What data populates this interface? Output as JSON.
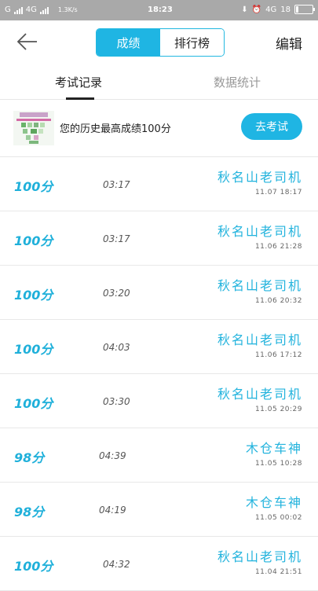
{
  "status_bar": {
    "carrier_left": "G",
    "network": "4G",
    "speed": "1.3K/s",
    "time": "18:23",
    "network_right": "4G",
    "battery_level": "18",
    "battery_fraction": 0.18
  },
  "nav": {
    "tabs": [
      {
        "label": "成绩",
        "active": true
      },
      {
        "label": "排行榜",
        "active": false
      }
    ],
    "edit_label": "编辑"
  },
  "subtabs": [
    {
      "label": "考试记录",
      "active": true
    },
    {
      "label": "数据统计",
      "active": false
    }
  ],
  "best": {
    "text": "您的历史最高成绩100分",
    "button": "去考试"
  },
  "records": [
    {
      "score": "100分",
      "duration": "03:17",
      "name": "秋名山老司机",
      "date": "11.07 18:17"
    },
    {
      "score": "100分",
      "duration": "03:17",
      "name": "秋名山老司机",
      "date": "11.06 21:28"
    },
    {
      "score": "100分",
      "duration": "03:20",
      "name": "秋名山老司机",
      "date": "11.06 20:32"
    },
    {
      "score": "100分",
      "duration": "04:03",
      "name": "秋名山老司机",
      "date": "11.06 17:12"
    },
    {
      "score": "100分",
      "duration": "03:30",
      "name": "秋名山老司机",
      "date": "11.05 20:29"
    },
    {
      "score": "98分",
      "duration": "04:39",
      "name": "木仓车神",
      "date": "11.05 10:28"
    },
    {
      "score": "98分",
      "duration": "04:19",
      "name": "木仓车神",
      "date": "11.05 00:02"
    },
    {
      "score": "100分",
      "duration": "04:32",
      "name": "秋名山老司机",
      "date": "11.04 21:51"
    }
  ],
  "colors": {
    "accent": "#1fb5e3",
    "status_bar": "#a9a9a9"
  }
}
